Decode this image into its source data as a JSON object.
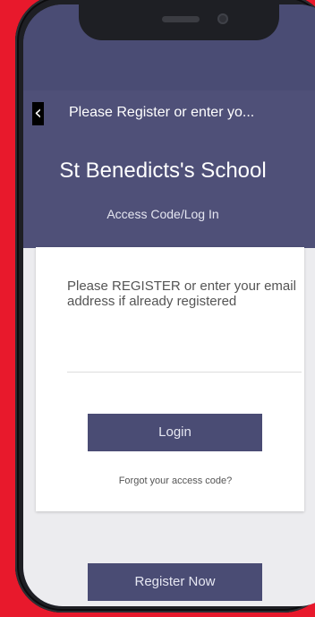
{
  "nav": {
    "back_icon": "chevron-left-icon",
    "back_glyph": "‹",
    "title": "Please Register or enter yo..."
  },
  "header": {
    "school_name": "St Benedicts's School",
    "subtitle": "Access Code/Log In"
  },
  "card": {
    "prompt": "Please REGISTER or enter your email address if already registered",
    "email_input_value": "",
    "email_input_placeholder": "",
    "login_label": "Login",
    "forgot_link_label": "Forgot your access code?"
  },
  "footer": {
    "register_label": "Register Now"
  },
  "colors": {
    "background_red": "#e8192c",
    "header_purple": "#4f5078",
    "button_purple": "#4a4c74",
    "content_gray": "#ececef",
    "card_white": "#ffffff"
  }
}
